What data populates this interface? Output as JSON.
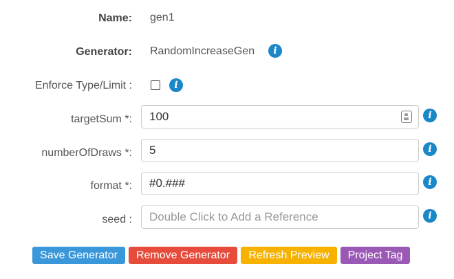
{
  "form": {
    "name": {
      "label": "Name:",
      "value": "gen1"
    },
    "generator": {
      "label": "Generator:",
      "value": "RandomIncreaseGen",
      "info_icon": "info-icon"
    },
    "enforce": {
      "label": "Enforce Type/Limit :",
      "checked": false,
      "info_icon": "info-icon"
    },
    "targetSum": {
      "label": "targetSum *:",
      "value": "100",
      "info_icon": "info-icon",
      "context_icon": "contact-card-icon"
    },
    "numberOfDraws": {
      "label": "numberOfDraws *:",
      "value": "5",
      "info_icon": "info-icon"
    },
    "format": {
      "label": "format *:",
      "value": "#0.###",
      "info_icon": "info-icon"
    },
    "seed": {
      "label": "seed :",
      "value": "",
      "placeholder": "Double Click to Add a Reference",
      "info_icon": "info-icon"
    }
  },
  "info_glyph": "i",
  "buttons": {
    "save": {
      "label": "Save Generator",
      "color": "#3a97d9"
    },
    "remove": {
      "label": "Remove Generator",
      "color": "#e64b3c"
    },
    "refresh": {
      "label": "Refresh Preview",
      "color": "#f7b200"
    },
    "tag": {
      "label": "Project Tag",
      "color": "#9b59b6"
    }
  },
  "colors": {
    "info": "#1a87c9",
    "text": "#555555"
  }
}
